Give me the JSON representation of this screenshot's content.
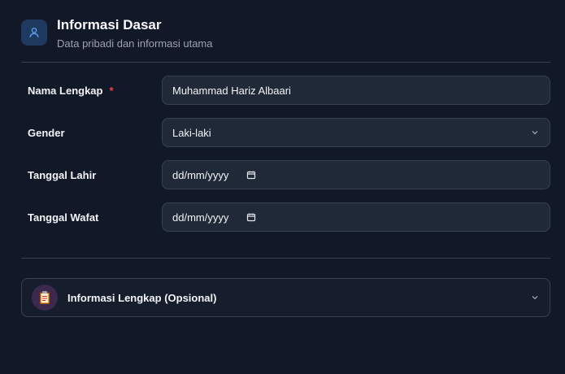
{
  "section": {
    "icon": "user-icon",
    "title": "Informasi Dasar",
    "subtitle": "Data pribadi dan informasi utama"
  },
  "form": {
    "full_name": {
      "label": "Nama Lengkap",
      "required_mark": "*",
      "value": "Muhammad Hariz Albaari"
    },
    "gender": {
      "label": "Gender",
      "selected": "Laki-laki"
    },
    "birth_date": {
      "label": "Tanggal Lahir",
      "placeholder": "dd/mm/yyyy"
    },
    "death_date": {
      "label": "Tanggal Wafat",
      "placeholder": "dd/mm/yyyy"
    }
  },
  "accordion": {
    "icon": "clipboard-icon",
    "title": "Informasi Lengkap (Opsional)"
  },
  "colors": {
    "background": "#111827",
    "field_bg": "#1f2937",
    "border": "#374151",
    "accent": "#3b82f6",
    "required": "#ef4444"
  }
}
